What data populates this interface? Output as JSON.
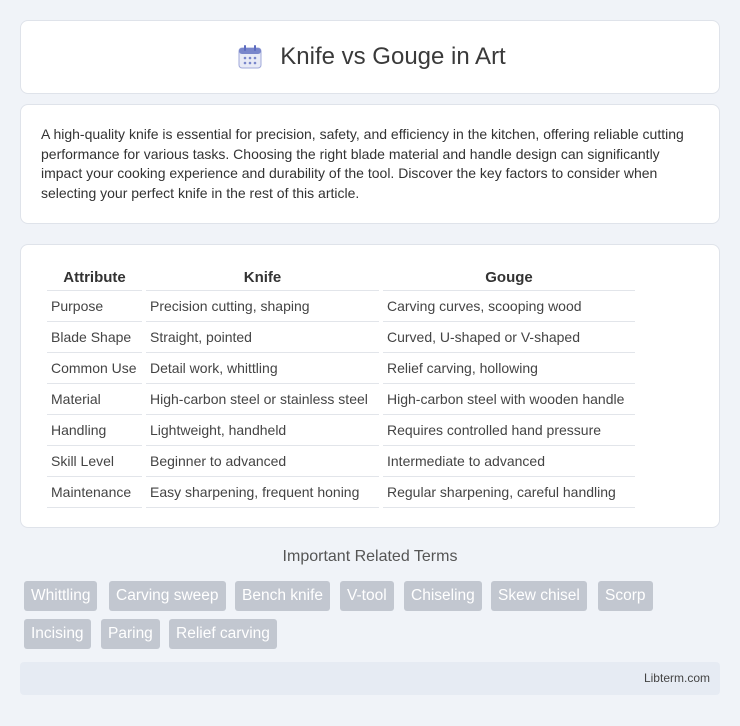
{
  "header": {
    "title": "Knife vs Gouge in Art"
  },
  "intro": {
    "text": "A high-quality knife is essential for precision, safety, and efficiency in the kitchen, offering reliable cutting performance for various tasks. Choosing the right blade material and handle design can significantly impact your cooking experience and durability of the tool. Discover the key factors to consider when selecting your perfect knife in the rest of this article."
  },
  "table": {
    "headers": [
      "Attribute",
      "Knife",
      "Gouge"
    ],
    "rows": [
      [
        "Purpose",
        "Precision cutting, shaping",
        "Carving curves, scooping wood"
      ],
      [
        "Blade Shape",
        "Straight, pointed",
        "Curved, U-shaped or V-shaped"
      ],
      [
        "Common Use",
        "Detail work, whittling",
        "Relief carving, hollowing"
      ],
      [
        "Material",
        "High-carbon steel or stainless steel",
        "High-carbon steel with wooden handle"
      ],
      [
        "Handling",
        "Lightweight, handheld",
        "Requires controlled hand pressure"
      ],
      [
        "Skill Level",
        "Beginner to advanced",
        "Intermediate to advanced"
      ],
      [
        "Maintenance",
        "Easy sharpening, frequent honing",
        "Regular sharpening, careful handling"
      ]
    ]
  },
  "related": {
    "title": "Important Related Terms",
    "tags": [
      "Whittling",
      "Carving sweep",
      "Bench knife",
      "V-tool",
      "Chiseling",
      "Skew chisel",
      "Scorp",
      "Incising",
      "Paring",
      "Relief carving"
    ]
  },
  "footer": {
    "text": "Libterm.com"
  }
}
